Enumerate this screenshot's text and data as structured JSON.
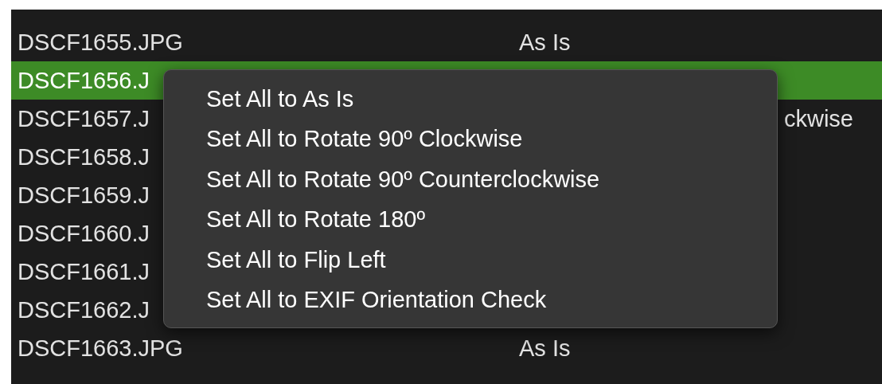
{
  "file_list": {
    "rows": [
      {
        "name": "DSCF1655.JPG",
        "orientation": "As Is",
        "selected": false
      },
      {
        "name": "DSCF1656.J",
        "selected": true
      },
      {
        "name": "DSCF1657.J",
        "orientation": "ckwise",
        "orientation_cut": true,
        "selected": false
      },
      {
        "name": "DSCF1658.J",
        "selected": false
      },
      {
        "name": "DSCF1659.J",
        "selected": false
      },
      {
        "name": "DSCF1660.J",
        "selected": false
      },
      {
        "name": "DSCF1661.J",
        "selected": false
      },
      {
        "name": "DSCF1662.J",
        "selected": false
      },
      {
        "name": "DSCF1663.JPG",
        "orientation": "As Is",
        "selected": false
      }
    ]
  },
  "context_menu": {
    "items": [
      {
        "label": "Set All to As Is"
      },
      {
        "label": "Set All to Rotate 90º Clockwise"
      },
      {
        "label": "Set All to Rotate 90º Counterclockwise"
      },
      {
        "label": "Set All to Rotate 180º"
      },
      {
        "label": "Set All to Flip Left"
      },
      {
        "label": "Set All to EXIF Orientation Check"
      }
    ]
  }
}
